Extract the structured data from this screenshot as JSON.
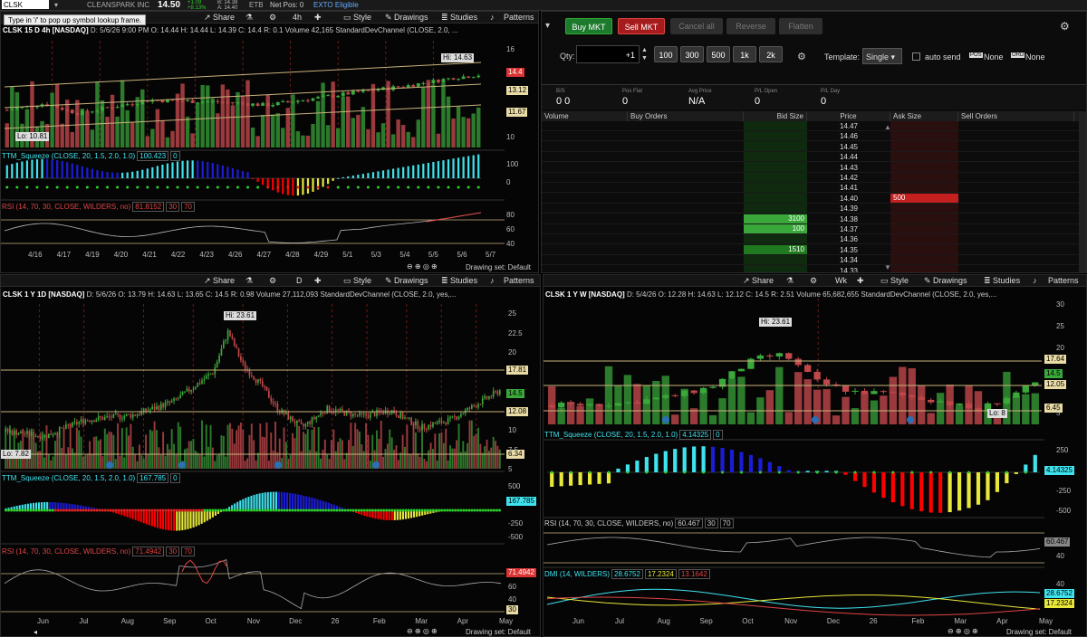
{
  "topbar": {
    "symbol": "CLSK",
    "company": "CLEANSPARK INC",
    "price": "14.50",
    "change_abs": "+1.09",
    "change_pct": "+8.13%",
    "bid": "B: 14.38",
    "ask": "A: 14.40",
    "exchange": "ETB",
    "net_pos": "Net Pos: 0",
    "exto": "EXTO Eligible",
    "tooltip": "Type in '/' to pop up symbol lookup frame."
  },
  "toolbar": {
    "share": "Share",
    "style": "Style",
    "drawings": "Drawings",
    "studies": "Studies",
    "patterns": "Patterns",
    "drawing_set": "Drawing set: Default"
  },
  "chart1": {
    "timeframe": "4h",
    "title": "CLSK 15 D 4h [NASDAQ]",
    "ohlc": "D: 5/6/26 9:00 PM  O: 14.44  H: 14.44  L: 14.39  C: 14.4  R: 0.1",
    "volume_label": "Volume",
    "volume": "42,165",
    "channel": "StandardDevChannel (CLOSE, 2.0, ...",
    "hi_label": "Hi: 14.63",
    "lo_label": "Lo: 10.81",
    "price_tags": [
      "14.4",
      "13.12",
      "11.67"
    ],
    "y_ticks": [
      "16",
      "14",
      "12",
      "10"
    ],
    "squeeze_title": "TTM_Squeeze (CLOSE, 20, 1.5, 2.0, 1.0)",
    "squeeze_value": "100.423",
    "squeeze_zero": "0",
    "squeeze_ticks": [
      "100",
      "0"
    ],
    "rsi_title": "RSI (14, 70, 30, CLOSE, WILDERS, no)",
    "rsi_value": "81.8152",
    "rsi_30": "30",
    "rsi_70": "70",
    "rsi_ticks": [
      "80",
      "60",
      "40"
    ],
    "x_labels": [
      "4/16",
      "4/17",
      "4/19",
      "4/20",
      "4/21",
      "4/22",
      "4/23",
      "4/26",
      "4/27",
      "4/28",
      "4/29",
      "5/1",
      "5/3",
      "5/4",
      "5/5",
      "5/6",
      "5/7"
    ]
  },
  "chart2": {
    "timeframe": "D",
    "title": "CLSK 1 Y 1D [NASDAQ]",
    "ohlc": "D: 5/6/26  O: 13.79  H: 14.63  L: 13.65  C: 14.5  R: 0.98",
    "volume_label": "Volume",
    "volume": "27,112,093",
    "channel": "StandardDevChannel (CLOSE, 2.0, yes,...",
    "hi_label": "Hi: 23.61",
    "lo_label": "Lo: 7.82",
    "price_tags": [
      "17.81",
      "14.5",
      "12.08",
      "6.34"
    ],
    "y_ticks": [
      "25",
      "22.5",
      "20",
      "17.5",
      "15",
      "12.5",
      "10",
      "7.5",
      "5"
    ],
    "squeeze_title": "TTM_Squeeze (CLOSE, 20, 1.5, 2.0, 1.0)",
    "squeeze_value": "167.785",
    "squeeze_zero": "0",
    "squeeze_ticks": [
      "500",
      "250",
      "-250",
      "-500"
    ],
    "squeeze_tag": "167.785",
    "rsi_title": "RSI (14, 70, 30, CLOSE, WILDERS, no)",
    "rsi_value": "71.4942",
    "rsi_30": "30",
    "rsi_70": "70",
    "rsi_tag": "71.4942",
    "rsi_ticks": [
      "80",
      "60",
      "40",
      "20"
    ],
    "x_labels": [
      "Jun",
      "Jul",
      "Aug",
      "Sep",
      "Oct",
      "Nov",
      "Dec",
      "26",
      "Feb",
      "Mar",
      "Apr",
      "May"
    ]
  },
  "chart3": {
    "timeframe": "Wk",
    "title": "CLSK 1 Y W [NASDAQ]",
    "ohlc": "D: 5/4/26  O: 12.28  H: 14.63  L: 12.12  C: 14.5  R: 2.51",
    "volume_label": "Volume",
    "volume": "65,682,655",
    "channel": "StandardDevChannel (CLOSE, 2.0, yes,...",
    "hi_label": "Hi: 23.61",
    "lo_label": "Lo: 8",
    "price_tags": [
      "17.64",
      "14.5",
      "12.05",
      "6.45"
    ],
    "y_ticks": [
      "30",
      "25",
      "20",
      "15",
      "10",
      "5"
    ],
    "squeeze_title": "TTM_Squeeze (CLOSE, 20, 1.5, 2.0, 1.0)",
    "squeeze_value": "4.14325",
    "squeeze_zero": "0",
    "squeeze_ticks": [
      "250",
      "0",
      "-250",
      "-500"
    ],
    "squeeze_tag": "4.14325",
    "rsi_title": "RSI (14, 70, 30, CLOSE, WILDERS, no)",
    "rsi_value": "60.467",
    "rsi_30": "30",
    "rsi_70": "70",
    "rsi_tag": "60.467",
    "rsi_ticks": [
      "60",
      "40"
    ],
    "dmi_title": "DMI (14, WILDERS)",
    "dmi_plus": "28.6752",
    "dmi_minus": "17.2324",
    "dmi_adx": "13.1642",
    "dmi_ticks": [
      "40",
      "20"
    ],
    "x_labels": [
      "Jun",
      "Jul",
      "Aug",
      "Sep",
      "Oct",
      "Nov",
      "Dec",
      "26",
      "Feb",
      "Mar",
      "Apr",
      "May"
    ]
  },
  "trade": {
    "buy_mkt": "Buy MKT",
    "sell_mkt": "Sell MKT",
    "cancel_all": "Cancel all",
    "reverse": "Reverse",
    "flatten": "Flatten",
    "qty_label": "Qty:",
    "qty_value": "+1",
    "qty_buttons": [
      "100",
      "300",
      "500",
      "1k",
      "2k"
    ],
    "template_label": "Template:",
    "template_value": "Single",
    "auto_send": "auto send",
    "pos_badge": "POS",
    "pos_value": "None",
    "ord_badge": "ORD",
    "ord_value": "None",
    "stats": [
      {
        "label": "B/S",
        "value": "0  0"
      },
      {
        "label": "Pos Flat",
        "value": "0"
      },
      {
        "label": "Avg Price",
        "value": "N/A"
      },
      {
        "label": "P/L Open",
        "value": "0"
      },
      {
        "label": "P/L Day",
        "value": "0"
      }
    ],
    "ladder_headers": [
      "Volume",
      "Buy Orders",
      "Bid Size",
      "Price",
      "Ask Size",
      "Sell Orders"
    ],
    "ladder": [
      {
        "price": "14.47",
        "bid": "",
        "ask": ""
      },
      {
        "price": "14.46",
        "bid": "",
        "ask": ""
      },
      {
        "price": "14.45",
        "bid": "",
        "ask": ""
      },
      {
        "price": "14.44",
        "bid": "",
        "ask": ""
      },
      {
        "price": "14.43",
        "bid": "",
        "ask": ""
      },
      {
        "price": "14.42",
        "bid": "",
        "ask": ""
      },
      {
        "price": "14.41",
        "bid": "",
        "ask": ""
      },
      {
        "price": "14.40",
        "bid": "",
        "ask": "500"
      },
      {
        "price": "14.39",
        "bid": "",
        "ask": ""
      },
      {
        "price": "14.38",
        "bid": "3100",
        "ask": ""
      },
      {
        "price": "14.37",
        "bid": "100",
        "ask": ""
      },
      {
        "price": "14.36",
        "bid": "",
        "ask": ""
      },
      {
        "price": "14.35",
        "bid": "1510",
        "ask": ""
      },
      {
        "price": "14.34",
        "bid": "",
        "ask": ""
      },
      {
        "price": "14.33",
        "bid": "",
        "ask": ""
      }
    ]
  },
  "colors": {
    "up": "#3aa83a",
    "down": "#c0474a",
    "squeeze_cyan": "#3fe3ee",
    "squeeze_blue": "#1c1cd8",
    "squeeze_red": "#f00",
    "squeeze_yellow": "#e8e83a",
    "channel": "#c9b27c"
  }
}
